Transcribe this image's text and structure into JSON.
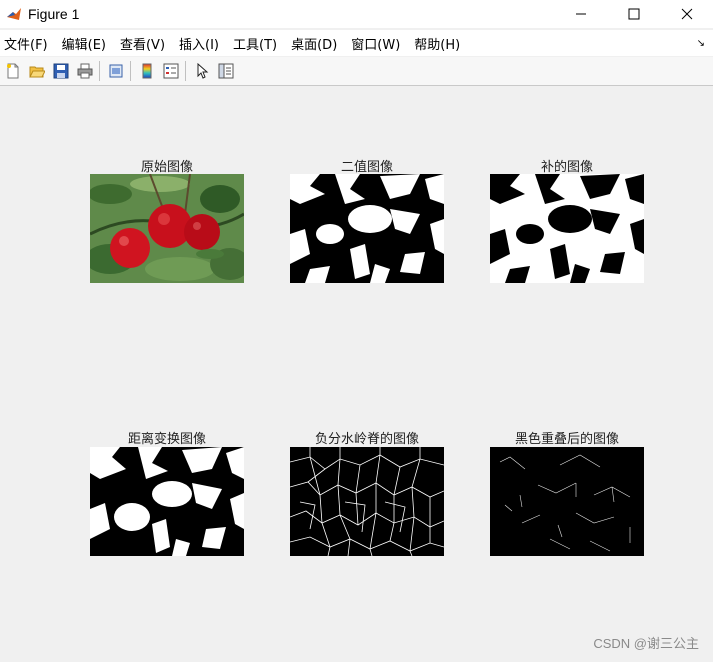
{
  "window": {
    "title": "Figure 1"
  },
  "menu": [
    "文件(F)",
    "编辑(E)",
    "查看(V)",
    "插入(I)",
    "工具(T)",
    "桌面(D)",
    "窗口(W)",
    "帮助(H)"
  ],
  "toolbar": {
    "icons": [
      "new-figure-icon",
      "open-folder-icon",
      "save-icon",
      "print-icon",
      "link-plot-icon",
      "insert-colorbar-icon",
      "insert-legend-icon",
      "edit-plot-arrow-icon",
      "property-inspector-icon"
    ]
  },
  "axes": [
    {
      "title": "原始图像",
      "kind": "photo"
    },
    {
      "title": "二值图像",
      "kind": "binary"
    },
    {
      "title": "补的图像",
      "kind": "complement"
    },
    {
      "title": "距离变换图像",
      "kind": "distance"
    },
    {
      "title": "负分水岭脊的图像",
      "kind": "ridges"
    },
    {
      "title": "黑色重叠后的图像",
      "kind": "overlay"
    }
  ],
  "colors": {
    "apple_red": "#c8101c",
    "leaf_green": "#4a7a3a",
    "background": "#f0f0f0"
  },
  "watermark": "CSDN @谢三公主"
}
